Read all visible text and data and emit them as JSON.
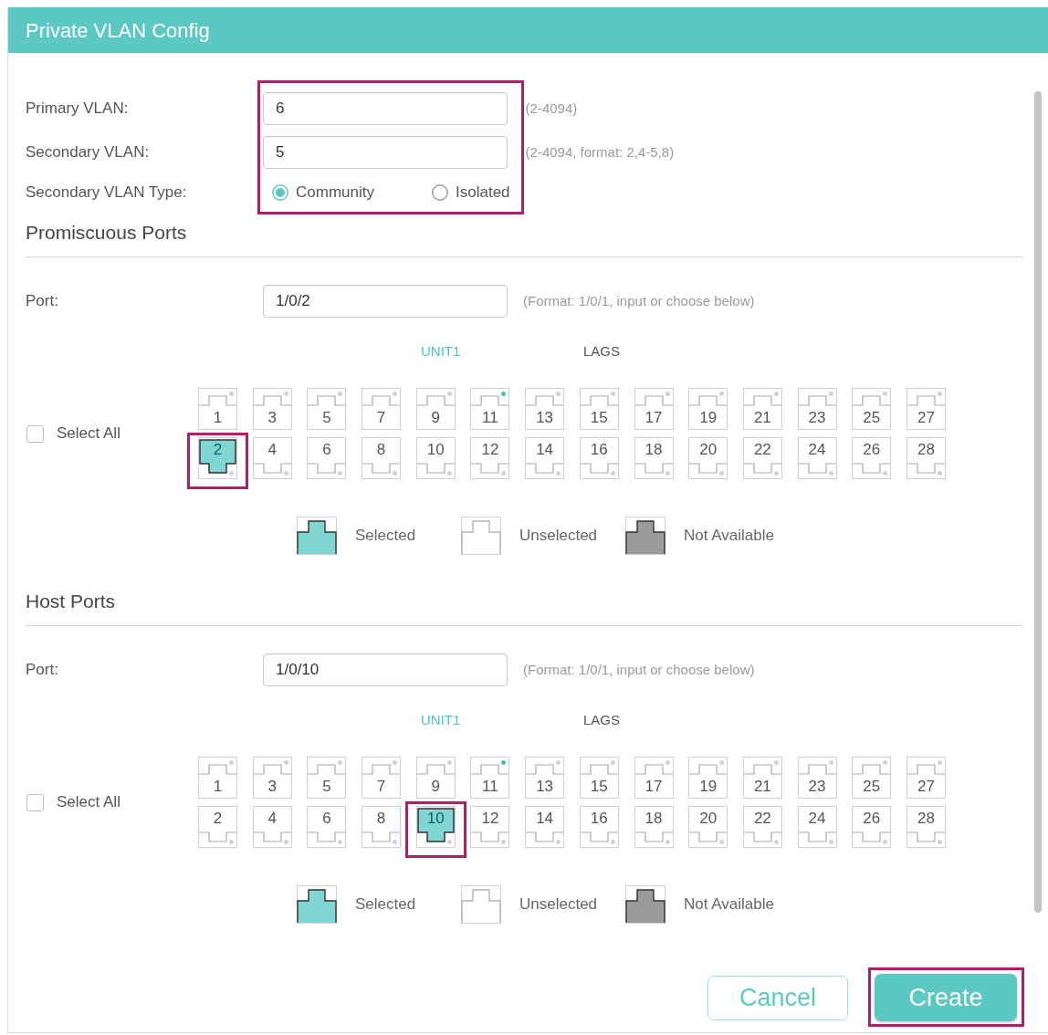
{
  "window": {
    "title": "Private VLAN Config"
  },
  "vlan_settings": {
    "highlighted": true,
    "fields": [
      {
        "label": "Primary VLAN:",
        "value": "6",
        "hint": "(2-4094)"
      },
      {
        "label": "Secondary VLAN:",
        "value": "5",
        "hint": "(2-4094, format: 2,4-5,8)"
      }
    ],
    "type": {
      "label": "Secondary VLAN Type:",
      "options": [
        {
          "label": "Community",
          "selected": true
        },
        {
          "label": "Isolated",
          "selected": false
        }
      ]
    }
  },
  "sections": [
    {
      "title": "Promiscuous Ports",
      "port": {
        "label": "Port:",
        "value": "1/0/2",
        "hint": "(Format: 1/0/1, input or choose below)"
      },
      "tabs": [
        {
          "label": "UNIT1",
          "selected": true
        },
        {
          "label": "LAGS",
          "selected": false
        }
      ],
      "select_all": {
        "label": "Select All",
        "checked": false
      },
      "port_rows": [
        [
          {
            "label": "1",
            "selected": false,
            "link": false,
            "highlighted": false
          },
          {
            "label": "3",
            "selected": false,
            "link": false,
            "highlighted": false
          },
          {
            "label": "5",
            "selected": false,
            "link": false,
            "highlighted": false
          },
          {
            "label": "7",
            "selected": false,
            "link": false,
            "highlighted": false
          },
          {
            "label": "9",
            "selected": false,
            "link": false,
            "highlighted": false
          },
          {
            "label": "11",
            "selected": false,
            "link": true,
            "highlighted": false
          },
          {
            "label": "13",
            "selected": false,
            "link": false,
            "highlighted": false
          },
          {
            "label": "15",
            "selected": false,
            "link": false,
            "highlighted": false
          },
          {
            "label": "17",
            "selected": false,
            "link": false,
            "highlighted": false
          },
          {
            "label": "19",
            "selected": false,
            "link": false,
            "highlighted": false
          },
          {
            "label": "21",
            "selected": false,
            "link": false,
            "highlighted": false
          },
          {
            "label": "23",
            "selected": false,
            "link": false,
            "highlighted": false
          },
          {
            "label": "25",
            "selected": false,
            "link": false,
            "highlighted": false
          },
          {
            "label": "27",
            "selected": false,
            "link": false,
            "highlighted": false
          }
        ],
        [
          {
            "label": "2",
            "selected": true,
            "link": false,
            "highlighted": true
          },
          {
            "label": "4",
            "selected": false,
            "link": false,
            "highlighted": false
          },
          {
            "label": "6",
            "selected": false,
            "link": false,
            "highlighted": false
          },
          {
            "label": "8",
            "selected": false,
            "link": false,
            "highlighted": false
          },
          {
            "label": "10",
            "selected": false,
            "link": false,
            "highlighted": false
          },
          {
            "label": "12",
            "selected": false,
            "link": false,
            "highlighted": false
          },
          {
            "label": "14",
            "selected": false,
            "link": false,
            "highlighted": false
          },
          {
            "label": "16",
            "selected": false,
            "link": false,
            "highlighted": false
          },
          {
            "label": "18",
            "selected": false,
            "link": false,
            "highlighted": false
          },
          {
            "label": "20",
            "selected": false,
            "link": false,
            "highlighted": false
          },
          {
            "label": "22",
            "selected": false,
            "link": false,
            "highlighted": false
          },
          {
            "label": "24",
            "selected": false,
            "link": false,
            "highlighted": false
          },
          {
            "label": "26",
            "selected": false,
            "link": false,
            "highlighted": false
          },
          {
            "label": "28",
            "selected": false,
            "link": false,
            "highlighted": false
          }
        ]
      ],
      "legend": [
        {
          "kind": "selected",
          "label": "Selected"
        },
        {
          "kind": "unselected",
          "label": "Unselected"
        },
        {
          "kind": "unavailable",
          "label": "Not Available"
        }
      ]
    },
    {
      "title": "Host Ports",
      "port": {
        "label": "Port:",
        "value": "1/0/10",
        "hint": "(Format: 1/0/1, input or choose below)"
      },
      "tabs": [
        {
          "label": "UNIT1",
          "selected": true
        },
        {
          "label": "LAGS",
          "selected": false
        }
      ],
      "select_all": {
        "label": "Select All",
        "checked": false
      },
      "port_rows": [
        [
          {
            "label": "1",
            "selected": false,
            "link": false,
            "highlighted": false
          },
          {
            "label": "3",
            "selected": false,
            "link": false,
            "highlighted": false
          },
          {
            "label": "5",
            "selected": false,
            "link": false,
            "highlighted": false
          },
          {
            "label": "7",
            "selected": false,
            "link": false,
            "highlighted": false
          },
          {
            "label": "9",
            "selected": false,
            "link": false,
            "highlighted": false
          },
          {
            "label": "11",
            "selected": false,
            "link": true,
            "highlighted": false
          },
          {
            "label": "13",
            "selected": false,
            "link": false,
            "highlighted": false
          },
          {
            "label": "15",
            "selected": false,
            "link": false,
            "highlighted": false
          },
          {
            "label": "17",
            "selected": false,
            "link": false,
            "highlighted": false
          },
          {
            "label": "19",
            "selected": false,
            "link": false,
            "highlighted": false
          },
          {
            "label": "21",
            "selected": false,
            "link": false,
            "highlighted": false
          },
          {
            "label": "23",
            "selected": false,
            "link": false,
            "highlighted": false
          },
          {
            "label": "25",
            "selected": false,
            "link": false,
            "highlighted": false
          },
          {
            "label": "27",
            "selected": false,
            "link": false,
            "highlighted": false
          }
        ],
        [
          {
            "label": "2",
            "selected": false,
            "link": false,
            "highlighted": false
          },
          {
            "label": "4",
            "selected": false,
            "link": false,
            "highlighted": false
          },
          {
            "label": "6",
            "selected": false,
            "link": false,
            "highlighted": false
          },
          {
            "label": "8",
            "selected": false,
            "link": false,
            "highlighted": false
          },
          {
            "label": "10",
            "selected": true,
            "link": false,
            "highlighted": true
          },
          {
            "label": "12",
            "selected": false,
            "link": false,
            "highlighted": false
          },
          {
            "label": "14",
            "selected": false,
            "link": false,
            "highlighted": false
          },
          {
            "label": "16",
            "selected": false,
            "link": false,
            "highlighted": false
          },
          {
            "label": "18",
            "selected": false,
            "link": false,
            "highlighted": false
          },
          {
            "label": "20",
            "selected": false,
            "link": false,
            "highlighted": false
          },
          {
            "label": "22",
            "selected": false,
            "link": false,
            "highlighted": false
          },
          {
            "label": "24",
            "selected": false,
            "link": false,
            "highlighted": false
          },
          {
            "label": "26",
            "selected": false,
            "link": false,
            "highlighted": false
          },
          {
            "label": "28",
            "selected": false,
            "link": false,
            "highlighted": false
          }
        ]
      ],
      "legend": [
        {
          "kind": "selected",
          "label": "Selected"
        },
        {
          "kind": "unselected",
          "label": "Unselected"
        },
        {
          "kind": "unavailable",
          "label": "Not Available"
        }
      ]
    }
  ],
  "buttons": [
    {
      "kind": "secondary",
      "label": "Cancel",
      "highlighted": false
    },
    {
      "kind": "primary",
      "label": "Create",
      "highlighted": true
    }
  ]
}
